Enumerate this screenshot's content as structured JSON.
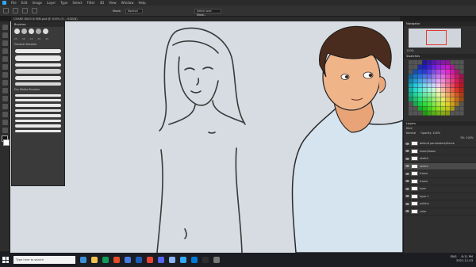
{
  "menubar": {
    "items": [
      "File",
      "Edit",
      "Image",
      "Layer",
      "Type",
      "Select",
      "Filter",
      "3D",
      "View",
      "Window",
      "Help"
    ]
  },
  "options": {
    "mode_label": "Mode:",
    "mode_value": "Normal",
    "select_mask": "Select and Mask..."
  },
  "document": {
    "tab": "CHARE 8000 N MIN.psd @ 100% (Y..., RGB/8)"
  },
  "brushes": {
    "title": "Brushes",
    "sizes": [
      "25",
      "50",
      "25",
      "25",
      "25",
      "25",
      "36",
      "25",
      "36",
      "25"
    ],
    "folder_1": "General Brushes",
    "folder_2": "Dry Media Brushes"
  },
  "navigator": {
    "title": "Navigator",
    "zoom": "100%"
  },
  "swatches": {
    "title": "Swatches"
  },
  "layers": {
    "title": "Layers",
    "kind": "Kind",
    "blend": "Normal",
    "opacity": "Opacity: 100%",
    "fill": "Fill: 100%",
    "rows": [
      "default parameters/frame",
      "moon/moon",
      "sketch",
      "sketch",
      "frame",
      "frame",
      "eyes",
      "layer 1",
      "outline",
      "color",
      "layer 2",
      "base",
      "base 2"
    ]
  },
  "status": {
    "zoom": "100%",
    "doc": "Doc: 26.6M/514.7M"
  },
  "taskbar": {
    "search_placeholder": "Type here to search",
    "time": "8:11 PM",
    "date": "2021-11-03",
    "lang": "ENG",
    "apps_colors": [
      "#3b8fd9",
      "#f2c14e",
      "#0f9d58",
      "#e34c26",
      "#4a7adf",
      "#1e5bb6",
      "#ea4335",
      "#5865f2",
      "#8ab4f8",
      "#31a8ff",
      "#0078d4",
      "#2e2e2e",
      "#777"
    ]
  }
}
